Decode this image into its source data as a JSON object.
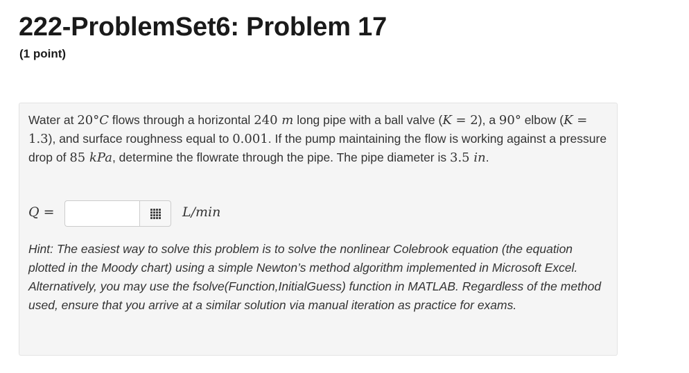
{
  "header": {
    "title": "222-ProblemSet6: Problem 17",
    "points": "(1 point)"
  },
  "problem": {
    "t1": "Water at ",
    "temp": "20°",
    "temp_unit": "C",
    "t2": " flows through a horizontal ",
    "length": "240 ",
    "length_unit": "m",
    "t3": " long pipe with a ball valve (",
    "k1_sym": "K",
    "k1_val": " = 2",
    "t4": "), a ",
    "angle": "90°",
    "t5": " elbow (",
    "k2_sym": "K",
    "k2_val": " = 1.3",
    "t6": "), and surface roughness equal to ",
    "roughness": "0.001",
    "t7": ". If the pump maintaining the flow is working against a pressure drop of ",
    "pressure": "85 ",
    "pressure_unit": "kPa",
    "t8": ", determine the flowrate through the pipe. The pipe diameter is ",
    "diameter": "3.5 ",
    "diameter_unit": "in",
    "t9": "."
  },
  "answer": {
    "var": "Q",
    "eq": " =",
    "value": "",
    "placeholder": "",
    "unit": "L/min",
    "palette_icon": "grid-icon"
  },
  "hint": {
    "text": "Hint: The easiest way to solve this problem is to solve the nonlinear Colebrook equation (the equation plotted in the Moody chart) using a simple Newton’s method algorithm implemented in Microsoft Excel. Alternatively, you may use the fsolve(Function,InitialGuess) function in MATLAB. Regardless of the method used, ensure that you arrive at a similar solution via manual iteration as practice for exams."
  }
}
